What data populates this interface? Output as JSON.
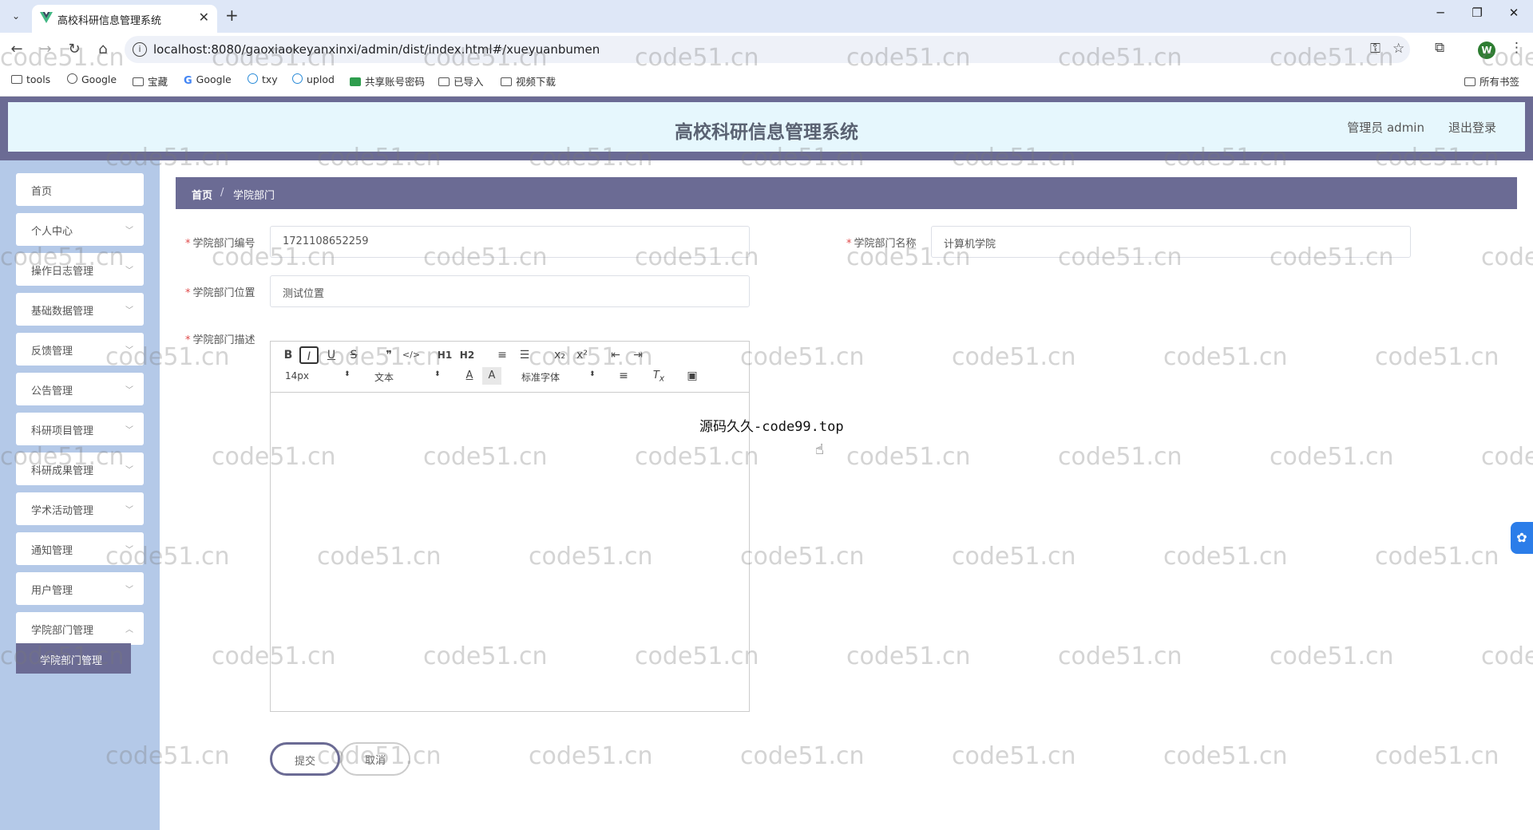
{
  "browser": {
    "tab_title": "高校科研信息管理系统",
    "new_tab": "+",
    "url": "localhost:8080/gaoxiaokeyanxinxi/admin/dist/index.html#/xueyuanbumen",
    "bookmarks": [
      "tools",
      "Google",
      "宝藏",
      "Google",
      "txy",
      "uplod",
      "共享账号密码",
      "已导入",
      "视频下载"
    ],
    "all_bookmarks": "所有书签",
    "profile_initial": "W"
  },
  "header": {
    "title": "高校科研信息管理系统",
    "admin": "管理员 admin",
    "logout": "退出登录"
  },
  "sidebar": {
    "items": [
      {
        "label": "首页"
      },
      {
        "label": "个人中心"
      },
      {
        "label": "操作日志管理"
      },
      {
        "label": "基础数据管理"
      },
      {
        "label": "反馈管理"
      },
      {
        "label": "公告管理"
      },
      {
        "label": "科研项目管理"
      },
      {
        "label": "科研成果管理"
      },
      {
        "label": "学术活动管理"
      },
      {
        "label": "通知管理"
      },
      {
        "label": "用户管理"
      },
      {
        "label": "学院部门管理"
      }
    ],
    "active_sub": "学院部门管理"
  },
  "breadcrumb": {
    "home": "首页",
    "sep": "/",
    "current": "学院部门"
  },
  "form": {
    "code_label": "学院部门编号",
    "code_value": "1721108652259",
    "name_label": "学院部门名称",
    "name_value": "计算机学院",
    "location_label": "学院部门位置",
    "location_value": "测试位置",
    "desc_label": "学院部门描述",
    "required_mark": "*"
  },
  "editor": {
    "font_size": "14px",
    "header": "文本",
    "font": "标准字体",
    "buttons": [
      "B",
      "I",
      "U",
      "S",
      "❞",
      "</>",
      "H1",
      "H2",
      "≡",
      "☰",
      "x₂",
      "x²",
      "⇤",
      "⇥"
    ]
  },
  "overlay_text": "源码久久-code99.top",
  "buttons": {
    "submit": "提交",
    "cancel": "取消"
  },
  "watermark": "code51.cn",
  "colors": {
    "theme": "#6b6b94",
    "header_bg": "#e6f7fd",
    "sidebar_bg": "#b4c9e8",
    "required": "#e04a4a"
  }
}
